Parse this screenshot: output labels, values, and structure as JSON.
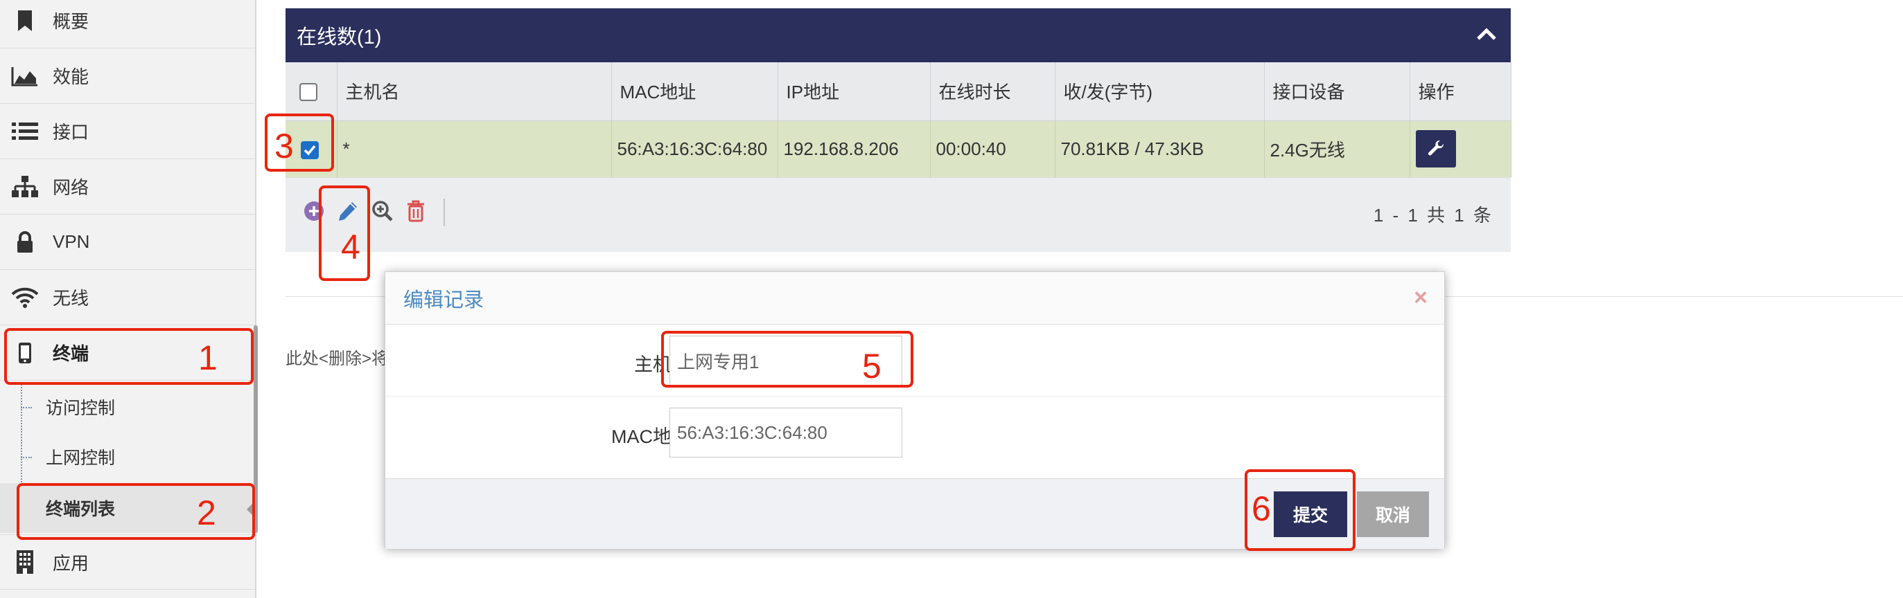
{
  "sidebar": {
    "items": [
      {
        "label": "概要",
        "icon": "bookmark-icon"
      },
      {
        "label": "效能",
        "icon": "area-chart-icon"
      },
      {
        "label": "接口",
        "icon": "list-icon"
      },
      {
        "label": "网络",
        "icon": "sitemap-icon"
      },
      {
        "label": "VPN",
        "icon": "lock-icon"
      },
      {
        "label": "无线",
        "icon": "wifi-icon"
      },
      {
        "label": "终端",
        "icon": "mobile-icon"
      }
    ],
    "subitems": [
      {
        "label": "访问控制"
      },
      {
        "label": "上网控制"
      },
      {
        "label": "终端列表"
      }
    ],
    "bottom_item": {
      "label": "应用",
      "icon": "building-icon"
    }
  },
  "panel": {
    "title": "在线数(1)",
    "columns": [
      "主机名",
      "MAC地址",
      "IP地址",
      "在线时长",
      "收/发(字节)",
      "接口设备",
      "操作"
    ],
    "row": {
      "hostname": "*",
      "mac": "56:A3:16:3C:64:80",
      "ip": "192.168.8.206",
      "online": "00:00:40",
      "traffic": "70.81KB / 47.3KB",
      "device": "2.4G无线"
    },
    "pagination": "1 - 1  共 1 条"
  },
  "note": "此处<删除>将",
  "modal": {
    "title": "编辑记录",
    "hostname_label": "主机名",
    "hostname_value": "上网专用1",
    "mac_label": "MAC地址",
    "mac_value": "56:A3:16:3C:64:80",
    "submit": "提交",
    "cancel": "取消"
  },
  "annotations": [
    "1",
    "2",
    "3",
    "4",
    "5",
    "6"
  ],
  "colors": {
    "header_navy": "#2b2f5c",
    "selected_row": "#dbe4c5",
    "annotation_red": "#e8250f",
    "modal_title": "#4b8ac3"
  }
}
